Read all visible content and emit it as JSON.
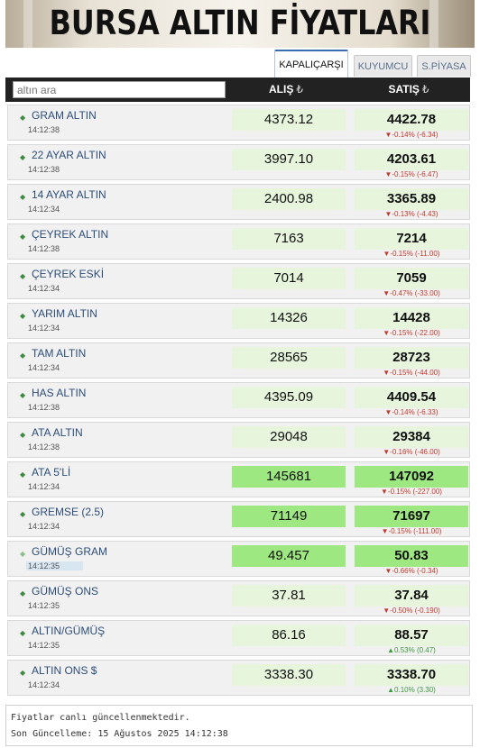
{
  "banner": {
    "title": "BURSA ALTIN FİYATLARI"
  },
  "tabs": [
    {
      "label": "KAPALIÇARŞI"
    },
    {
      "label": "KUYUMCU"
    },
    {
      "label": "S.PİYASA"
    }
  ],
  "header": {
    "search_placeholder": "altın ara",
    "buy_label": "ALIŞ",
    "sell_label": "SATIŞ",
    "currency_symbol": "₺"
  },
  "rows": [
    {
      "name": "GRAM ALTIN",
      "time": "14:12:38",
      "buy": "4373.12",
      "sell": "4422.78",
      "change": "▼-0.14% (-6.34)"
    },
    {
      "name": "22 AYAR ALTIN",
      "time": "14:12:38",
      "buy": "3997.10",
      "sell": "4203.61",
      "change": "▼-0.15% (-6.47)"
    },
    {
      "name": "14 AYAR ALTIN",
      "time": "14:12:34",
      "buy": "2400.98",
      "sell": "3365.89",
      "change": "▼-0.13% (-4.43)"
    },
    {
      "name": "ÇEYREK ALTIN",
      "time": "14:12:38",
      "buy": "7163",
      "sell": "7214",
      "change": "▼-0.15% (-11.00)"
    },
    {
      "name": "ÇEYREK ESKİ",
      "time": "14:12:34",
      "buy": "7014",
      "sell": "7059",
      "change": "▼-0.47% (-33.00)"
    },
    {
      "name": "YARIM ALTIN",
      "time": "14:12:34",
      "buy": "14326",
      "sell": "14428",
      "change": "▼-0.15% (-22.00)"
    },
    {
      "name": "TAM ALTIN",
      "time": "14:12:34",
      "buy": "28565",
      "sell": "28723",
      "change": "▼-0.15% (-44.00)"
    },
    {
      "name": "HAS ALTIN",
      "time": "14:12:38",
      "buy": "4395.09",
      "sell": "4409.54",
      "change": "▼-0.14% (-6.33)"
    },
    {
      "name": "ATA ALTIN",
      "time": "14:12:38",
      "buy": "29048",
      "sell": "29384",
      "change": "▼-0.16% (-46.00)"
    },
    {
      "name": "ATA 5'Lİ",
      "time": "14:12:34",
      "buy": "145681",
      "sell": "147092",
      "change": "▼-0.15% (-227.00)"
    },
    {
      "name": "GREMSE (2.5)",
      "time": "14:12:34",
      "buy": "71149",
      "sell": "71697",
      "change": "▼-0.15% (-111.00)"
    },
    {
      "name": "GÜMÜŞ GRAM",
      "time": "14:12:35",
      "buy": "49.457",
      "sell": "50.83",
      "change": "▼-0.66% (-0.34)"
    },
    {
      "name": "GÜMÜŞ ONS",
      "time": "14:12:35",
      "buy": "37.81",
      "sell": "37.84",
      "change": "▼-0.50% (-0.190)"
    },
    {
      "name": "ALTIN/GÜMÜŞ",
      "time": "14:12:35",
      "buy": "86.16",
      "sell": "88.57",
      "change": "▲0.53% (0.47)"
    },
    {
      "name": "ALTIN ONS $",
      "time": "14:12:34",
      "buy": "3338.30",
      "sell": "3338.70",
      "change": "▲0.10% (3.30)"
    }
  ],
  "footer": {
    "status": "Fiyatlar canlı güncellenmektedir.",
    "last_update": "Son Güncelleme: 15 Ağustos 2025 14:12:38"
  },
  "colors": {
    "header_bg": "#222222",
    "value_bg": "#e6f5dc",
    "value_highlight": "#9ee882",
    "down": "#c0392b",
    "up": "#3b9a3b",
    "name": "#2d4e78"
  }
}
